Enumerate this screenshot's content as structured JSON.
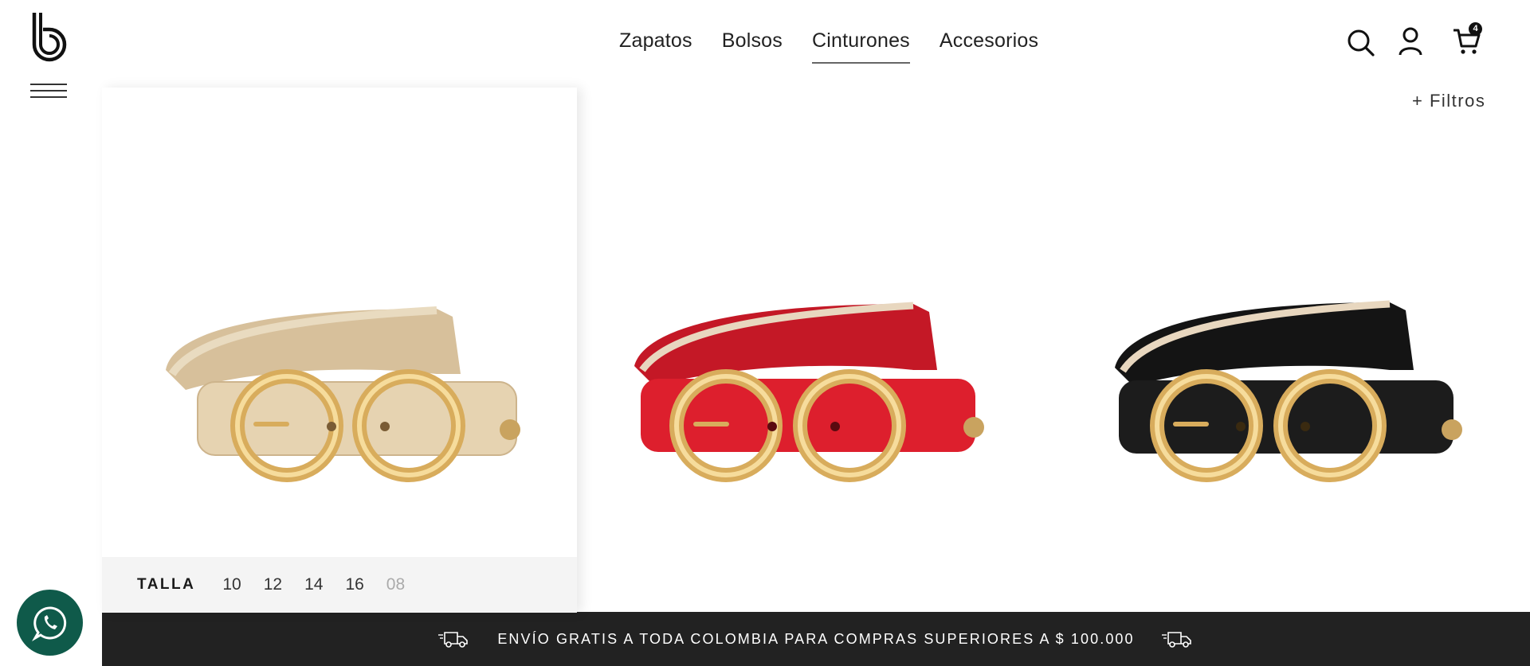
{
  "brand": {
    "logo_icon": "b-logo-icon"
  },
  "nav": {
    "items": [
      {
        "label": "Zapatos",
        "active": false
      },
      {
        "label": "Bolsos",
        "active": false
      },
      {
        "label": "Cinturones",
        "active": true
      },
      {
        "label": "Accesorios",
        "active": false
      }
    ]
  },
  "header": {
    "search_icon": "search-icon",
    "account_icon": "user-icon",
    "cart_icon": "cart-icon",
    "cart_count": "4"
  },
  "filters": {
    "label": "+ Filtros"
  },
  "products": [
    {
      "color_name": "beige",
      "color": "#e6d3b1",
      "hovered": true
    },
    {
      "color_name": "red",
      "color": "#dd1f2d",
      "hovered": false
    },
    {
      "color_name": "black",
      "color": "#1c1c1c",
      "hovered": false
    }
  ],
  "size_selector": {
    "label": "TALLA",
    "options": [
      {
        "value": "10",
        "available": true
      },
      {
        "value": "12",
        "available": true
      },
      {
        "value": "14",
        "available": true
      },
      {
        "value": "16",
        "available": true
      },
      {
        "value": "08",
        "available": false
      }
    ]
  },
  "shipping_bar": {
    "text": "ENVÍO GRATIS A TODA COLOMBIA PARA COMPRAS SUPERIORES A $ 100.000",
    "icon": "delivery-truck-icon",
    "background": "#222222"
  },
  "whatsapp": {
    "icon": "whatsapp-icon",
    "color": "#0f5a4a"
  }
}
